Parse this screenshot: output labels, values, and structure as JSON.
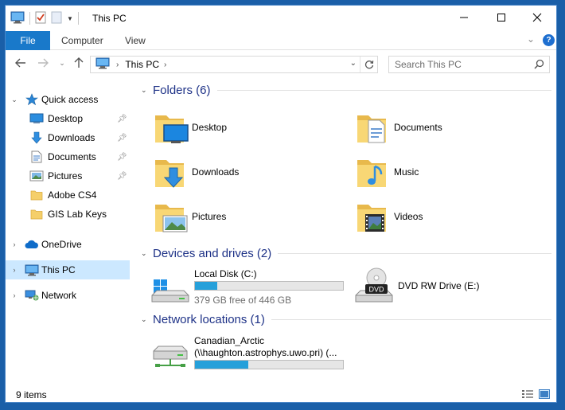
{
  "window": {
    "title": "This PC"
  },
  "ribbon": {
    "file_tab": "File",
    "computer_tab": "Computer",
    "view_tab": "View",
    "help": "?"
  },
  "address": {
    "location": "This PC"
  },
  "search": {
    "placeholder": "Search This PC"
  },
  "navpane": {
    "quick_access": "Quick access",
    "items": [
      {
        "label": "Desktop",
        "icon": "desktop-icon",
        "pinned": true
      },
      {
        "label": "Downloads",
        "icon": "downloads-icon",
        "pinned": true
      },
      {
        "label": "Documents",
        "icon": "documents-icon",
        "pinned": true
      },
      {
        "label": "Pictures",
        "icon": "pictures-icon",
        "pinned": true
      },
      {
        "label": "Adobe CS4",
        "icon": "folder-icon",
        "pinned": false
      },
      {
        "label": "GIS Lab Keys",
        "icon": "folder-icon",
        "pinned": false
      }
    ],
    "onedrive": "OneDrive",
    "this_pc": "This PC",
    "network": "Network"
  },
  "groups": {
    "folders": {
      "title": "Folders (6)"
    },
    "devices": {
      "title": "Devices and drives (2)"
    },
    "network": {
      "title": "Network locations (1)"
    }
  },
  "folders": [
    {
      "label": "Desktop",
      "icon": "desktop-folder-icon"
    },
    {
      "label": "Documents",
      "icon": "documents-folder-icon"
    },
    {
      "label": "Downloads",
      "icon": "downloads-folder-icon"
    },
    {
      "label": "Music",
      "icon": "music-folder-icon"
    },
    {
      "label": "Pictures",
      "icon": "pictures-folder-icon"
    },
    {
      "label": "Videos",
      "icon": "videos-folder-icon"
    }
  ],
  "drives": [
    {
      "name": "Local Disk (C:)",
      "free": "379 GB free of 446 GB",
      "used_fraction": 0.15
    },
    {
      "name": "DVD RW Drive (E:)",
      "badge": "DVD"
    }
  ],
  "network_locations": [
    {
      "name": "Canadian_Arctic",
      "path": "(\\\\haughton.astrophys.uwo.pri) (...",
      "used_fraction": 0.36
    }
  ],
  "status": {
    "items": "9 items"
  },
  "colors": {
    "accent": "#1979ca",
    "selected": "#cce8ff",
    "group_title": "#1e3287",
    "bar_fill": "#26a0da"
  }
}
